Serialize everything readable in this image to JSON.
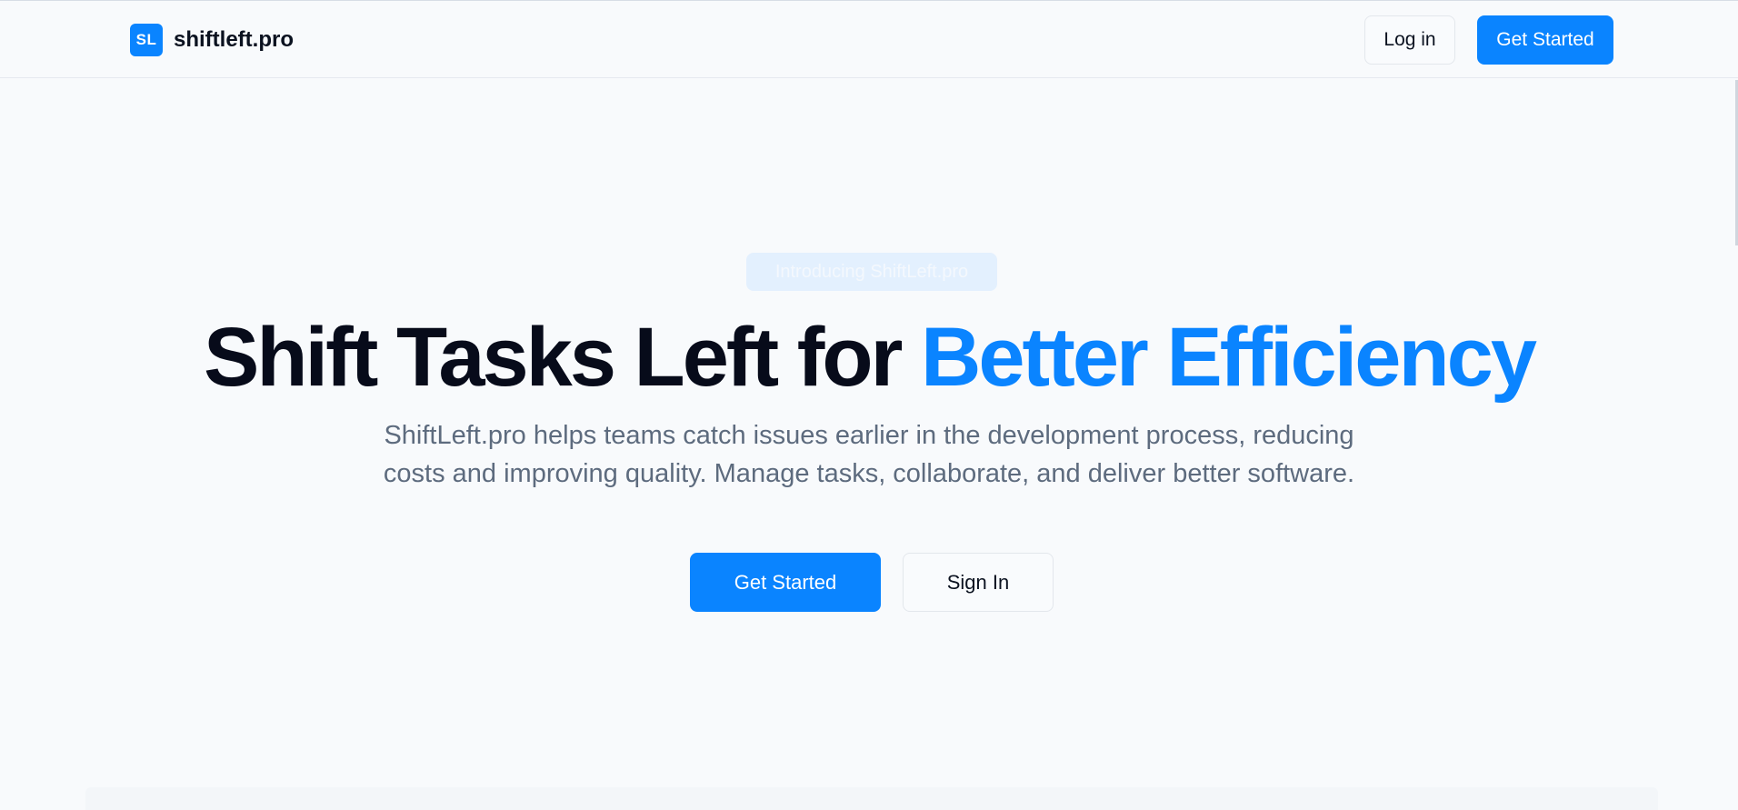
{
  "brand": {
    "logo_text": "SL",
    "name": "shiftleft.pro"
  },
  "nav": {
    "login_label": "Log in",
    "get_started_label": "Get Started"
  },
  "hero": {
    "badge": "Introducing ShiftLeft.pro",
    "title_main": "Shift Tasks Left for ",
    "title_accent": "Better Efficiency",
    "description": "ShiftLeft.pro helps teams catch issues earlier in the development process, reducing costs and improving quality. Manage tasks, collaborate, and deliver better software.",
    "primary_cta": "Get Started",
    "secondary_cta": "Sign In"
  },
  "colors": {
    "accent": "#0a84ff",
    "background": "#f8fafc",
    "heading": "#070b1a",
    "body_text": "#5d6b7e"
  }
}
